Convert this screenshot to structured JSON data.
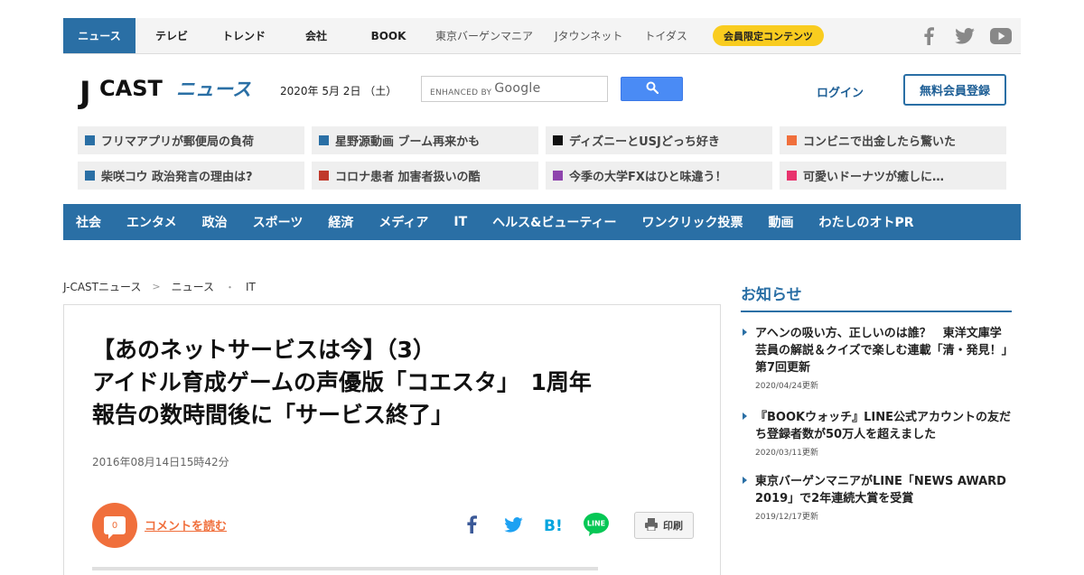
{
  "topnav": {
    "items": [
      "ニュース",
      "テレビ",
      "トレンド",
      "会社",
      "BOOK",
      "東京バーゲンマニア",
      "Jタウンネット",
      "トイダス"
    ],
    "member_badge": "会員限定コンテンツ",
    "social_icons": [
      "facebook-icon",
      "twitter-icon",
      "youtube-icon"
    ]
  },
  "header": {
    "logo_j": "J",
    "logo_cast": "CAST",
    "logo_news": "ニュース",
    "date": "2020年 5月 2日 （土）",
    "search_enhanced": "ENHANCED BY",
    "search_google": "Google",
    "login": "ログイン",
    "signup": "無料会員登録"
  },
  "pickups": [
    {
      "label": "フリマアプリが郵便局の負荷",
      "color": "#2a6fa5"
    },
    {
      "label": "星野源動画 ブーム再来かも",
      "color": "#2a6fa5"
    },
    {
      "label": "ディズニーとUSJどっち好き",
      "color": "#111111"
    },
    {
      "label": "コンビニで出金したら驚いた",
      "color": "#f06f3c"
    },
    {
      "label": "柴咲コウ 政治発言の理由は?",
      "color": "#2a6fa5"
    },
    {
      "label": "コロナ患者 加害者扱いの酷",
      "color": "#c0392b"
    },
    {
      "label": "今季の大学FXはひと味違う！",
      "color": "#8e44ad"
    },
    {
      "label": "可愛いドーナツが癒しに…",
      "color": "#e8336d"
    }
  ],
  "categories": [
    "社会",
    "エンタメ",
    "政治",
    "スポーツ",
    "経済",
    "メディア",
    "IT",
    "ヘルス&ビューティー",
    "ワンクリック投票",
    "動画",
    "わたしのオトPR"
  ],
  "breadcrumb": [
    "J-CASTニュース",
    "ニュース",
    "IT"
  ],
  "breadcrumb_seps": [
    ">",
    "・"
  ],
  "article": {
    "title_line1": "【あのネットサービスは今】（3）",
    "title_line2": "アイドル育成ゲームの声優版「コエスタ」　1周年",
    "title_line3": "報告の数時間後に「サービス終了」",
    "datetime": "2016年08月14日15時42分",
    "comment_count": "0",
    "comment_link": "コメントを読む",
    "share_icons": [
      "facebook-icon",
      "twitter-icon",
      "hatena-bookmark-icon",
      "line-icon"
    ],
    "hatena_label": "B!",
    "line_label": "LINE",
    "print": "印刷"
  },
  "sidebar": {
    "title": "お知らせ",
    "notices": [
      {
        "text": "アヘンの吸い方、正しいのは誰？　東洋文庫学芸員の解説＆クイズで楽しむ連載「清・発見！」第7回更新",
        "date": "2020/04/24更新"
      },
      {
        "text": "『BOOKウォッチ』LINE公式アカウントの友だち登録者数が50万人を超えました",
        "date": "2020/03/11更新"
      },
      {
        "text": "東京バーゲンマニアがLINE「NEWS AWARD 2019」で2年連続大賞を受賞",
        "date": "2019/12/17更新"
      }
    ]
  },
  "colors": {
    "brand_blue": "#2a6fa5",
    "accent_orange": "#f06f3c",
    "badge_yellow": "#f9cc1f",
    "google_blue": "#4a8bf5",
    "line_green": "#06c755"
  }
}
